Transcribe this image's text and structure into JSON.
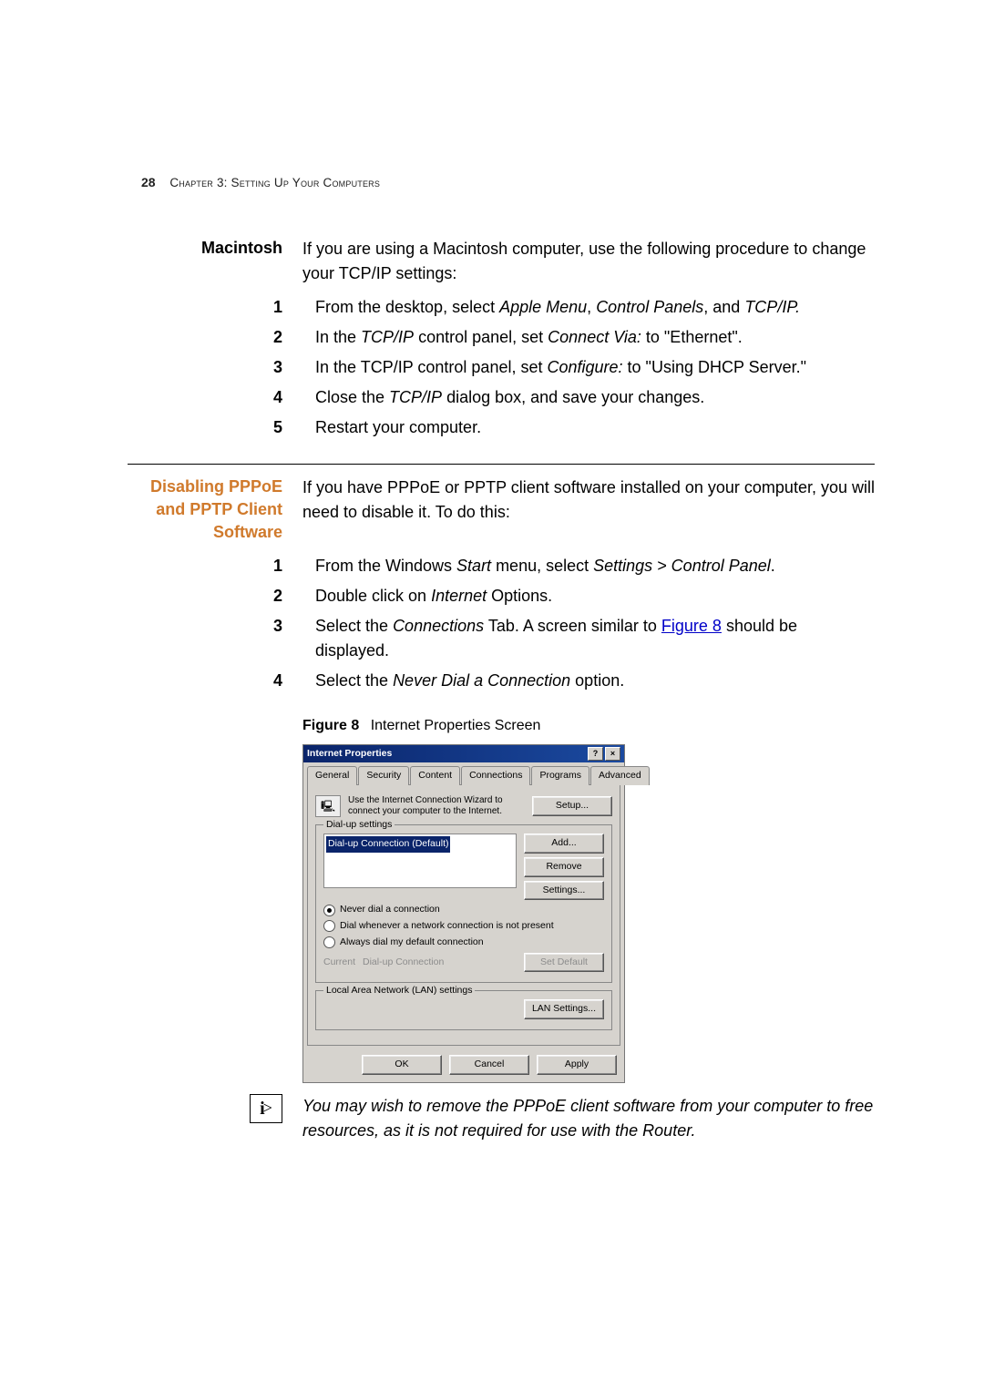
{
  "header": {
    "page_number": "28",
    "chapter": "Chapter 3: Setting Up Your Computers"
  },
  "section1": {
    "side_label": "Macintosh",
    "intro": "If you are using a Macintosh computer, use the following procedure to change your TCP/IP settings:",
    "steps": [
      {
        "n": "1",
        "pre": "From the desktop, select ",
        "i1": "Apple Menu",
        "mid1": ", ",
        "i2": "Control Panels",
        "mid2": ", and ",
        "i3": "TCP/IP.",
        "post": ""
      },
      {
        "n": "2",
        "pre": "In the ",
        "i1": "TCP/IP",
        "mid1": " control panel, set ",
        "i2": "Connect Via:",
        "mid2": " to \"Ethernet\".",
        "i3": "",
        "post": ""
      },
      {
        "n": "3",
        "pre": "In the TCP/IP control panel, set ",
        "i1": "Configure:",
        "mid1": " to \"Using DHCP Server.\"",
        "i2": "",
        "mid2": "",
        "i3": "",
        "post": ""
      },
      {
        "n": "4",
        "pre": "Close the ",
        "i1": "TCP/IP",
        "mid1": " dialog box, and save your changes.",
        "i2": "",
        "mid2": "",
        "i3": "",
        "post": ""
      },
      {
        "n": "5",
        "pre": "Restart your computer.",
        "i1": "",
        "mid1": "",
        "i2": "",
        "mid2": "",
        "i3": "",
        "post": ""
      }
    ]
  },
  "section2": {
    "side_label": "Disabling PPPoE and PPTP Client Software",
    "intro": "If you have PPPoE or PPTP client software installed on your computer, you will need to disable it. To do this:",
    "steps": [
      {
        "n": "1",
        "pre": "From the Windows ",
        "i1": "Start",
        "mid1": " menu, select ",
        "i2": "Settings > Control Panel",
        "mid2": ".",
        "i3": "",
        "post": ""
      },
      {
        "n": "2",
        "pre": "Double click on ",
        "i1": "Internet",
        "mid1": " Options.",
        "i2": "",
        "mid2": "",
        "i3": "",
        "post": ""
      },
      {
        "n": "3",
        "pre": "Select the ",
        "i1": "Connections",
        "mid1": " Tab. A screen similar to ",
        "link": "Figure 8",
        "post": " should be displayed."
      },
      {
        "n": "4",
        "pre": "Select the ",
        "i1": "Never Dial a Connection",
        "mid1": " option.",
        "i2": "",
        "mid2": "",
        "i3": "",
        "post": ""
      }
    ],
    "figure": {
      "label": "Figure 8",
      "caption": "Internet Properties Screen"
    }
  },
  "dialog": {
    "title": "Internet Properties",
    "help_btn": "?",
    "close_btn": "×",
    "tabs": {
      "general": "General",
      "security": "Security",
      "content": "Content",
      "connections": "Connections",
      "programs": "Programs",
      "advanced": "Advanced"
    },
    "wizard_text": "Use the Internet Connection Wizard to connect your computer to the Internet.",
    "setup_btn": "Setup...",
    "dialup_legend": "Dial-up settings",
    "dialup_item": "Dial-up Connection (Default)",
    "add_btn": "Add...",
    "remove_btn": "Remove",
    "settings_btn": "Settings...",
    "radio1": "Never dial a connection",
    "radio2": "Dial whenever a network connection is not present",
    "radio3": "Always dial my default connection",
    "current_lbl": "Current",
    "current_val": "Dial-up Connection",
    "set_default_btn": "Set Default",
    "lan_legend": "Local Area Network (LAN) settings",
    "lan_btn": "LAN Settings...",
    "ok_btn": "OK",
    "cancel_btn": "Cancel",
    "apply_btn": "Apply"
  },
  "tip": {
    "text": "You may wish to remove the PPPoE client software from your computer to free resources, as it is not required for use with the Router."
  }
}
